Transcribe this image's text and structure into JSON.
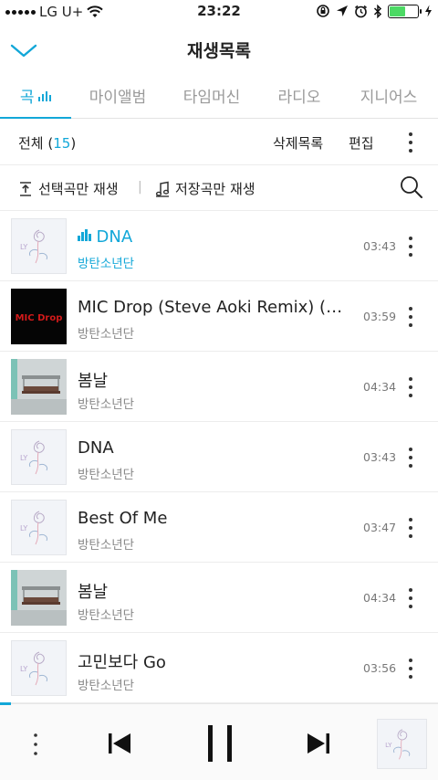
{
  "status_bar": {
    "carrier": "LG U+",
    "time": "23:22"
  },
  "header": {
    "title": "재생목록"
  },
  "tabs": [
    {
      "label": "곡",
      "active": true
    },
    {
      "label": "마이앨범",
      "active": false
    },
    {
      "label": "타임머신",
      "active": false
    },
    {
      "label": "라디오",
      "active": false
    },
    {
      "label": "지니어스",
      "active": false
    }
  ],
  "list_header": {
    "all_label": "전체",
    "count": "15",
    "delete_list_label": "삭제목록",
    "edit_label": "편집"
  },
  "actions": {
    "play_selected_label": "선택곡만 재생",
    "play_saved_label": "저장곡만 재생"
  },
  "songs": [
    {
      "title": "DNA",
      "artist": "방탄소년단",
      "duration": "03:43",
      "art": "bts-love-yourself"
    },
    {
      "title": "MIC Drop (Steve Aoki Remix) (F...",
      "artist": "방탄소년단",
      "duration": "03:59",
      "art": "mic-drop"
    },
    {
      "title": "봄날",
      "artist": "방탄소년단",
      "duration": "04:34",
      "art": "you-never-walk-alone"
    },
    {
      "title": "DNA",
      "artist": "방탄소년단",
      "duration": "03:43",
      "art": "bts-love-yourself"
    },
    {
      "title": "Best Of Me",
      "artist": "방탄소년단",
      "duration": "03:47",
      "art": "bts-love-yourself"
    },
    {
      "title": "봄날",
      "artist": "방탄소년단",
      "duration": "04:34",
      "art": "you-never-walk-alone"
    },
    {
      "title": "고민보다 Go",
      "artist": "방탄소년단",
      "duration": "03:56",
      "art": "bts-love-yourself"
    }
  ],
  "album_art_text": {
    "mic_drop": "MIC Drop",
    "ly": "LY"
  },
  "player": {
    "progress_fraction": 0.025,
    "state": "playing"
  },
  "colors": {
    "accent": "#12a7d8",
    "battery": "#4cd964"
  }
}
